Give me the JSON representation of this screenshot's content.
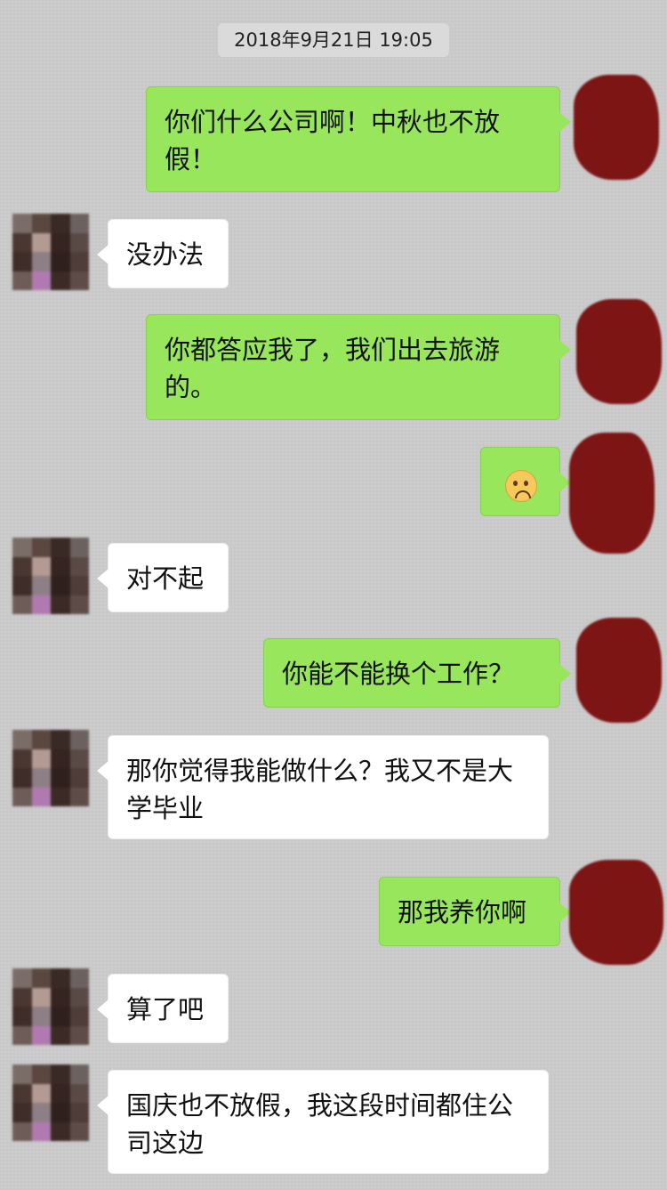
{
  "timestamp": "2018年9月21日 19:05",
  "messages": [
    {
      "sender": "me",
      "text": "你们什么公司啊！中秋也不放假！"
    },
    {
      "sender": "them",
      "text": "没办法"
    },
    {
      "sender": "me",
      "text": "你都答应我了，我们出去旅游的。"
    },
    {
      "sender": "me",
      "emoji": "frowning-face-icon"
    },
    {
      "sender": "them",
      "text": "对不起"
    },
    {
      "sender": "me",
      "text": "你能不能换个工作？"
    },
    {
      "sender": "them",
      "text": "那你觉得我能做什么？我又不是大学毕业"
    },
    {
      "sender": "me",
      "text": "那我养你啊"
    },
    {
      "sender": "them",
      "text": "算了吧"
    },
    {
      "sender": "them",
      "text": "国庆也不放假，我这段时间都住公司这边"
    }
  ],
  "colors": {
    "background": "#c9c9c9",
    "my_bubble": "#97e65b",
    "their_bubble": "#ffffff",
    "my_avatar_redaction": "#7d1515"
  }
}
